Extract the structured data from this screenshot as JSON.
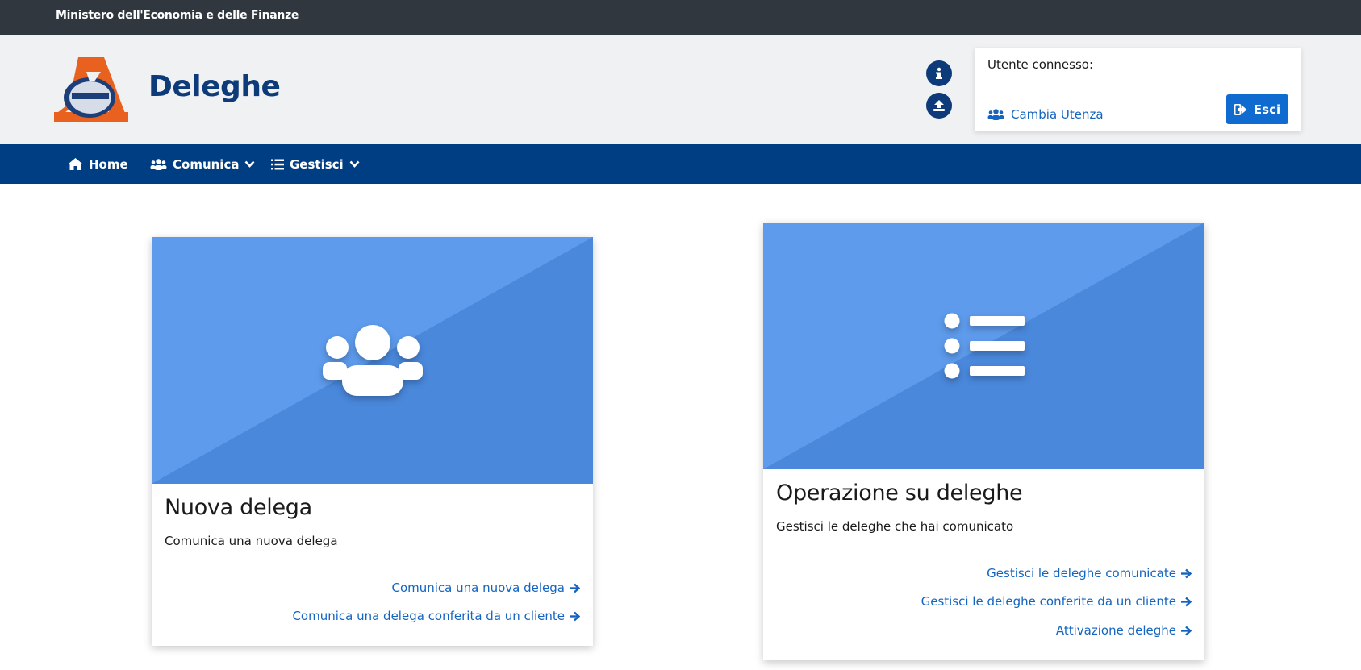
{
  "topbar": {
    "ministry": "Ministero dell'Economia e delle Finanze"
  },
  "header": {
    "app_title": "Deleghe",
    "logo_icon": "agenzia-entrate-logo",
    "info_icon": "info-icon",
    "upload_icon": "upload-icon"
  },
  "user_box": {
    "label": "Utente connesso:",
    "switch_label": "Cambia Utenza",
    "switch_icon": "users-icon",
    "exit_label": "Esci",
    "exit_icon": "sign-out-icon"
  },
  "nav": {
    "items": [
      {
        "label": "Home",
        "icon": "home-icon"
      },
      {
        "label": "Comunica",
        "icon": "users-icon",
        "dropdown": true
      },
      {
        "label": "Gestisci",
        "icon": "list-icon",
        "dropdown": true
      }
    ]
  },
  "cards": [
    {
      "title": "Nuova delega",
      "description": "Comunica una nuova delega",
      "icon": "users-icon",
      "links": [
        "Comunica una nuova delega",
        "Comunica una delega conferita da un cliente"
      ]
    },
    {
      "title": "Operazione su deleghe",
      "description": "Gestisci le deleghe che hai comunicato",
      "icon": "list-icon",
      "links": [
        "Gestisci le deleghe comunicate",
        "Gestisci le deleghe conferite da un cliente",
        "Attivazione deleghe"
      ]
    }
  ],
  "colors": {
    "topbar": "#30373f",
    "header_bg": "#f0f1f3",
    "navbar": "#003e84",
    "brand_blue": "#0d3b79",
    "button_blue": "#0f6bd0",
    "link_blue": "#1565c0",
    "banner_light": "#5e9bec",
    "banner_dark": "#4a88dc",
    "logo_orange": "#e8611f"
  }
}
